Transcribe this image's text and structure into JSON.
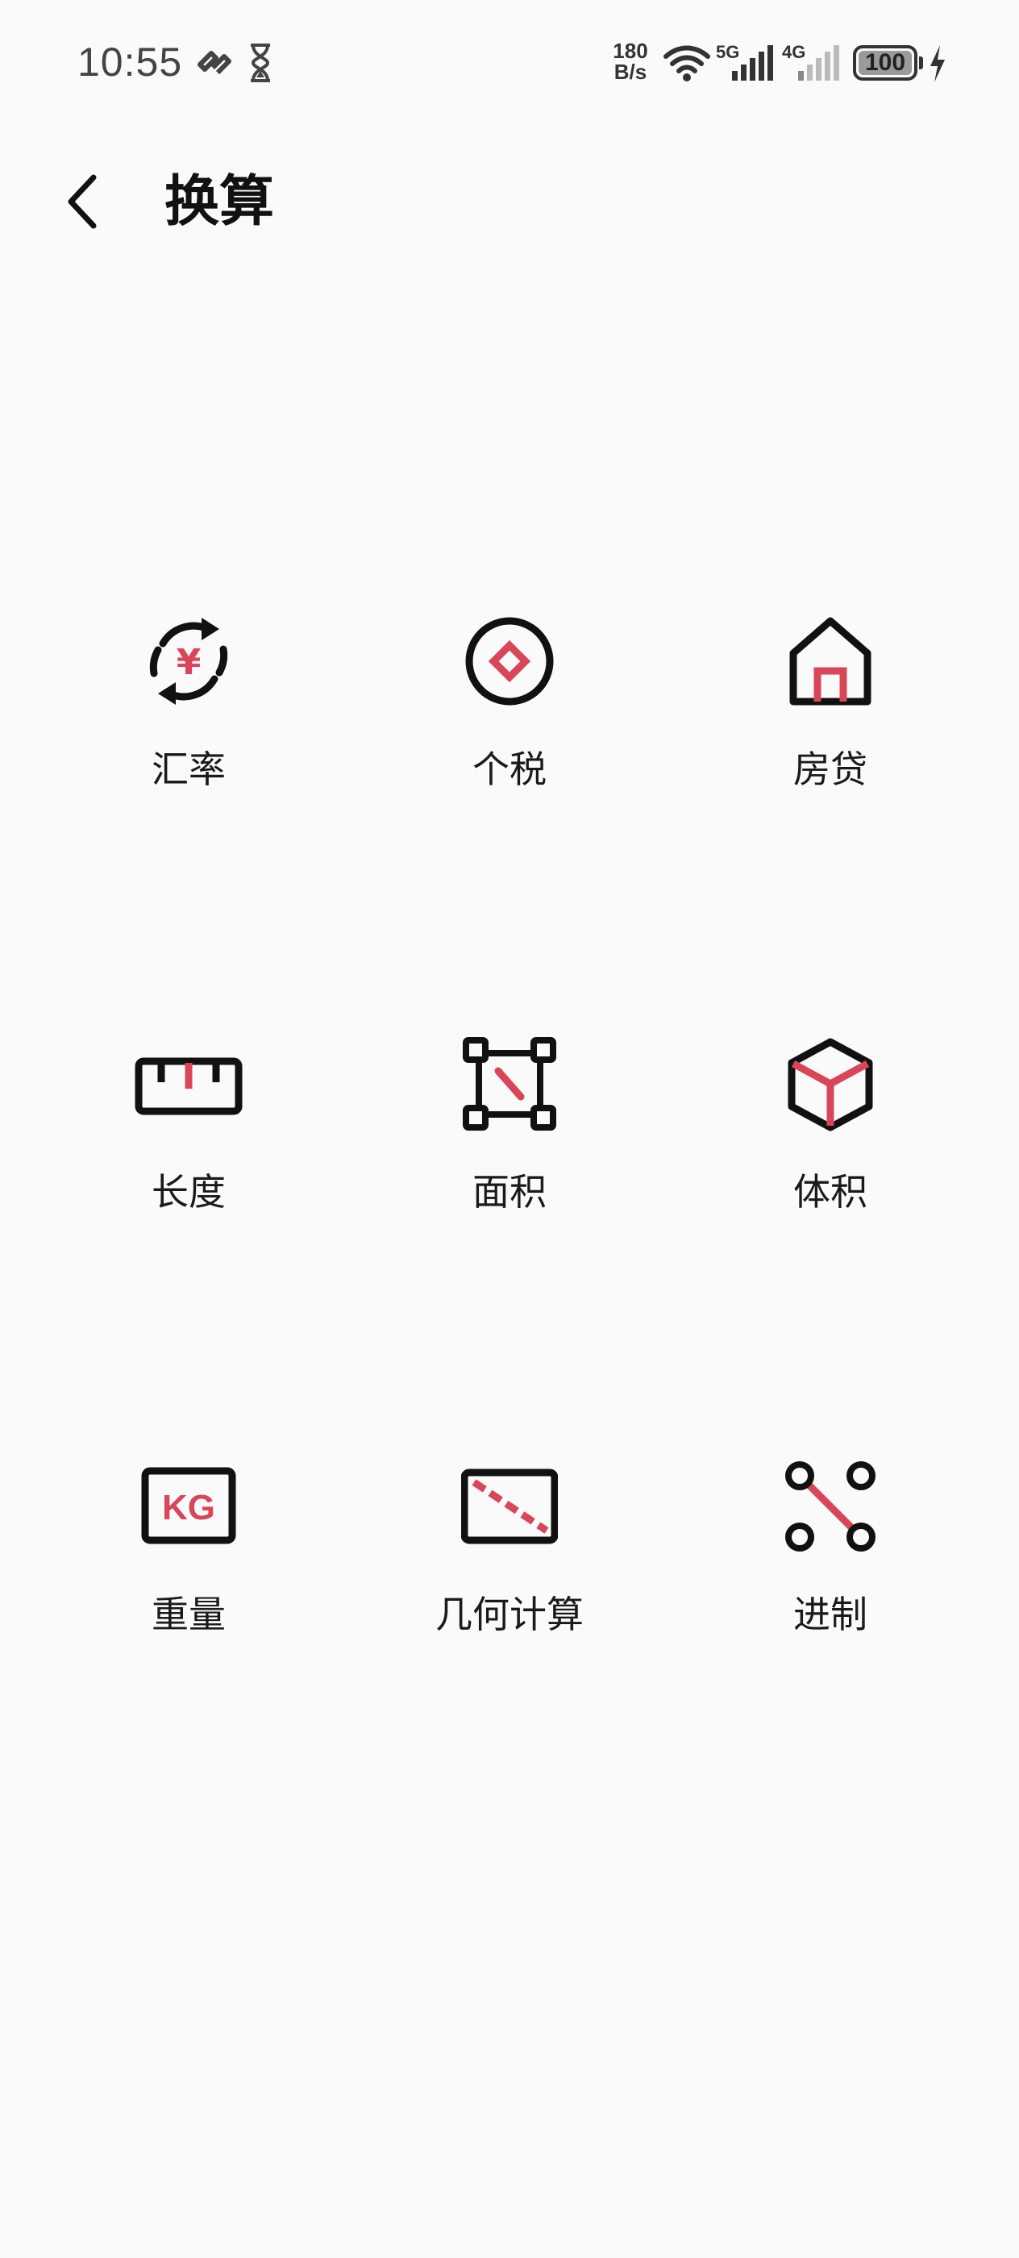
{
  "status_bar": {
    "time": "10:55",
    "net_speed_value": "180",
    "net_speed_unit": "B/s",
    "sim1_label": "5G",
    "sim2_label": "4G",
    "battery_level": "100",
    "icons": [
      "link-icon",
      "hourglass-icon",
      "wifi-icon",
      "signal-5g-icon",
      "signal-4g-icon",
      "battery-icon",
      "charging-icon"
    ]
  },
  "header": {
    "title": "换算",
    "back_icon": "chevron-left-icon"
  },
  "colors": {
    "accent": "#d9465a",
    "stroke": "#111111",
    "background": "#fafafa"
  },
  "tools": [
    {
      "label": "汇率",
      "icon": "currency-exchange-icon"
    },
    {
      "label": "个税",
      "icon": "tax-coin-icon"
    },
    {
      "label": "房贷",
      "icon": "house-icon"
    },
    {
      "label": "长度",
      "icon": "ruler-icon"
    },
    {
      "label": "面积",
      "icon": "area-icon"
    },
    {
      "label": "体积",
      "icon": "cube-icon"
    },
    {
      "label": "重量",
      "icon": "weight-kg-icon"
    },
    {
      "label": "几何计算",
      "icon": "geometry-icon"
    },
    {
      "label": "进制",
      "icon": "number-base-icon"
    }
  ],
  "tool_icon_text": {
    "yuan": "¥",
    "kg": "KG"
  }
}
